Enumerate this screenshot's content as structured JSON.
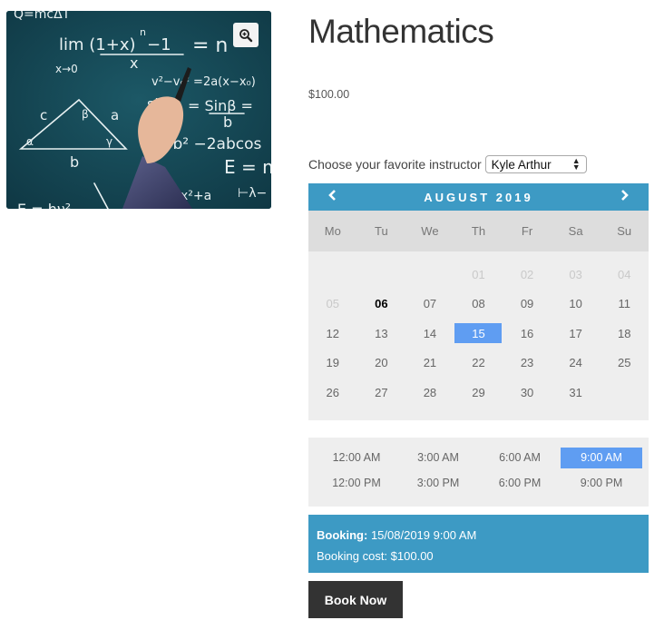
{
  "product": {
    "title": "Mathematics",
    "price": "$100.00",
    "image_alt": "Hand writing math formulas on a chalkboard",
    "image_formulas": [
      "Q=mcΔT",
      "lim (1+x)ⁿ −1 = n",
      "x",
      "x→0",
      "v²−v₀² = 2a(x−x₀)",
      "sinα/a = sinβ/b =",
      "a²+b²−2abcos",
      "E = m",
      "y=x²+a",
      "c",
      "β",
      "a",
      "α",
      "γ",
      "b"
    ],
    "zoom_icon": "zoom-in-icon"
  },
  "instructor": {
    "label": "Choose your favorite instructor",
    "selected": "Kyle Arthur"
  },
  "calendar": {
    "month_label": "AUGUST 2019",
    "prev_icon": "‹",
    "next_icon": "›",
    "weekdays": [
      "Mo",
      "Tu",
      "We",
      "Th",
      "Fr",
      "Sa",
      "Su"
    ],
    "days": [
      {
        "label": "",
        "state": "empty"
      },
      {
        "label": "",
        "state": "empty"
      },
      {
        "label": "",
        "state": "empty"
      },
      {
        "label": "01",
        "state": "disabled"
      },
      {
        "label": "02",
        "state": "disabled"
      },
      {
        "label": "03",
        "state": "disabled"
      },
      {
        "label": "04",
        "state": "disabled"
      },
      {
        "label": "05",
        "state": "disabled"
      },
      {
        "label": "06",
        "state": "today"
      },
      {
        "label": "07",
        "state": "available"
      },
      {
        "label": "08",
        "state": "available"
      },
      {
        "label": "09",
        "state": "available"
      },
      {
        "label": "10",
        "state": "available"
      },
      {
        "label": "11",
        "state": "available"
      },
      {
        "label": "12",
        "state": "available"
      },
      {
        "label": "13",
        "state": "available"
      },
      {
        "label": "14",
        "state": "available"
      },
      {
        "label": "15",
        "state": "selected"
      },
      {
        "label": "16",
        "state": "available"
      },
      {
        "label": "17",
        "state": "available"
      },
      {
        "label": "18",
        "state": "available"
      },
      {
        "label": "19",
        "state": "available"
      },
      {
        "label": "20",
        "state": "available"
      },
      {
        "label": "21",
        "state": "available"
      },
      {
        "label": "22",
        "state": "available"
      },
      {
        "label": "23",
        "state": "available"
      },
      {
        "label": "24",
        "state": "available"
      },
      {
        "label": "25",
        "state": "available"
      },
      {
        "label": "26",
        "state": "available"
      },
      {
        "label": "27",
        "state": "available"
      },
      {
        "label": "28",
        "state": "available"
      },
      {
        "label": "29",
        "state": "available"
      },
      {
        "label": "30",
        "state": "available"
      },
      {
        "label": "31",
        "state": "available"
      }
    ]
  },
  "time_slots": [
    {
      "label": "12:00 AM",
      "selected": false
    },
    {
      "label": "3:00 AM",
      "selected": false
    },
    {
      "label": "6:00 AM",
      "selected": false
    },
    {
      "label": "9:00 AM",
      "selected": true
    },
    {
      "label": "12:00 PM",
      "selected": false
    },
    {
      "label": "3:00 PM",
      "selected": false
    },
    {
      "label": "6:00 PM",
      "selected": false
    },
    {
      "label": "9:00 PM",
      "selected": false
    }
  ],
  "booking": {
    "booking_label": "Booking:",
    "booking_value": "15/08/2019 9:00 AM",
    "cost_label": "Booking cost:",
    "cost_value": "$100.00"
  },
  "book_button": "Book Now",
  "colors": {
    "accent_blue": "#3d9ac4",
    "selected_blue": "#5f9df2",
    "button_dark": "#333333"
  }
}
